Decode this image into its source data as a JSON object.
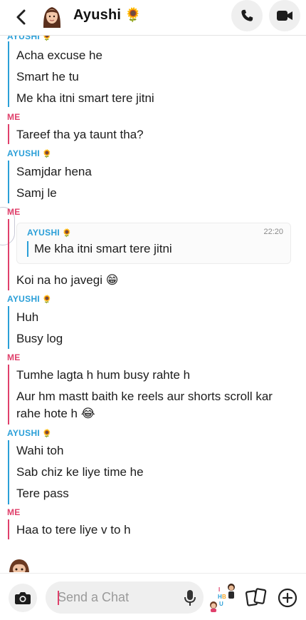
{
  "header": {
    "contact_name": "Ayushi",
    "contact_emoji": "🌻",
    "icons": [
      "back-chevron-icon",
      "bitmoji-avatar-icon",
      "phone-icon",
      "video-camera-icon"
    ]
  },
  "labels": {
    "ayushi": "AYUSHI",
    "me": "ME",
    "sender_emoji": "🌻"
  },
  "messages": [
    {
      "sender": "ayushi",
      "text": "Acha excuse he"
    },
    {
      "sender": "ayushi",
      "text": "Smart he tu"
    },
    {
      "sender": "ayushi",
      "text": "Me kha itni smart tere jitni"
    },
    {
      "sender": "me",
      "text": "Tareef tha ya taunt tha?"
    },
    {
      "sender": "ayushi",
      "text": "Samjdar hena"
    },
    {
      "sender": "ayushi",
      "text": "Samj le"
    },
    {
      "sender": "me",
      "text": "Koi na ho javegi 😁"
    },
    {
      "sender": "ayushi",
      "text": "Huh"
    },
    {
      "sender": "ayushi",
      "text": "Busy log"
    },
    {
      "sender": "me",
      "text": "Tumhe lagta h hum busy rahte h"
    },
    {
      "sender": "me",
      "text_line1": "Aur hm mastt baith ke reels aur shorts scroll kar",
      "text_line2": "rahe hote h 😂"
    },
    {
      "sender": "ayushi",
      "text": "Wahi toh"
    },
    {
      "sender": "ayushi",
      "text": "Sab chiz ke liye time he"
    },
    {
      "sender": "ayushi",
      "text": "Tere pass"
    },
    {
      "sender": "me",
      "text": "Haa to tere liye v to h"
    }
  ],
  "quoted_reply": {
    "name": "AYUSHI",
    "emoji": "🌻",
    "time": "22:20",
    "text": "Me kha itni smart tere jitni"
  },
  "composer": {
    "placeholder": "Send a Chat",
    "icons": [
      "camera-icon",
      "microphone-icon",
      "bitmoji-sticker-icon",
      "cards-icon",
      "plus-icon"
    ]
  },
  "colors": {
    "ayushi": "#2a9fd8",
    "me": "#e0406b",
    "button_bg": "#efefef"
  }
}
